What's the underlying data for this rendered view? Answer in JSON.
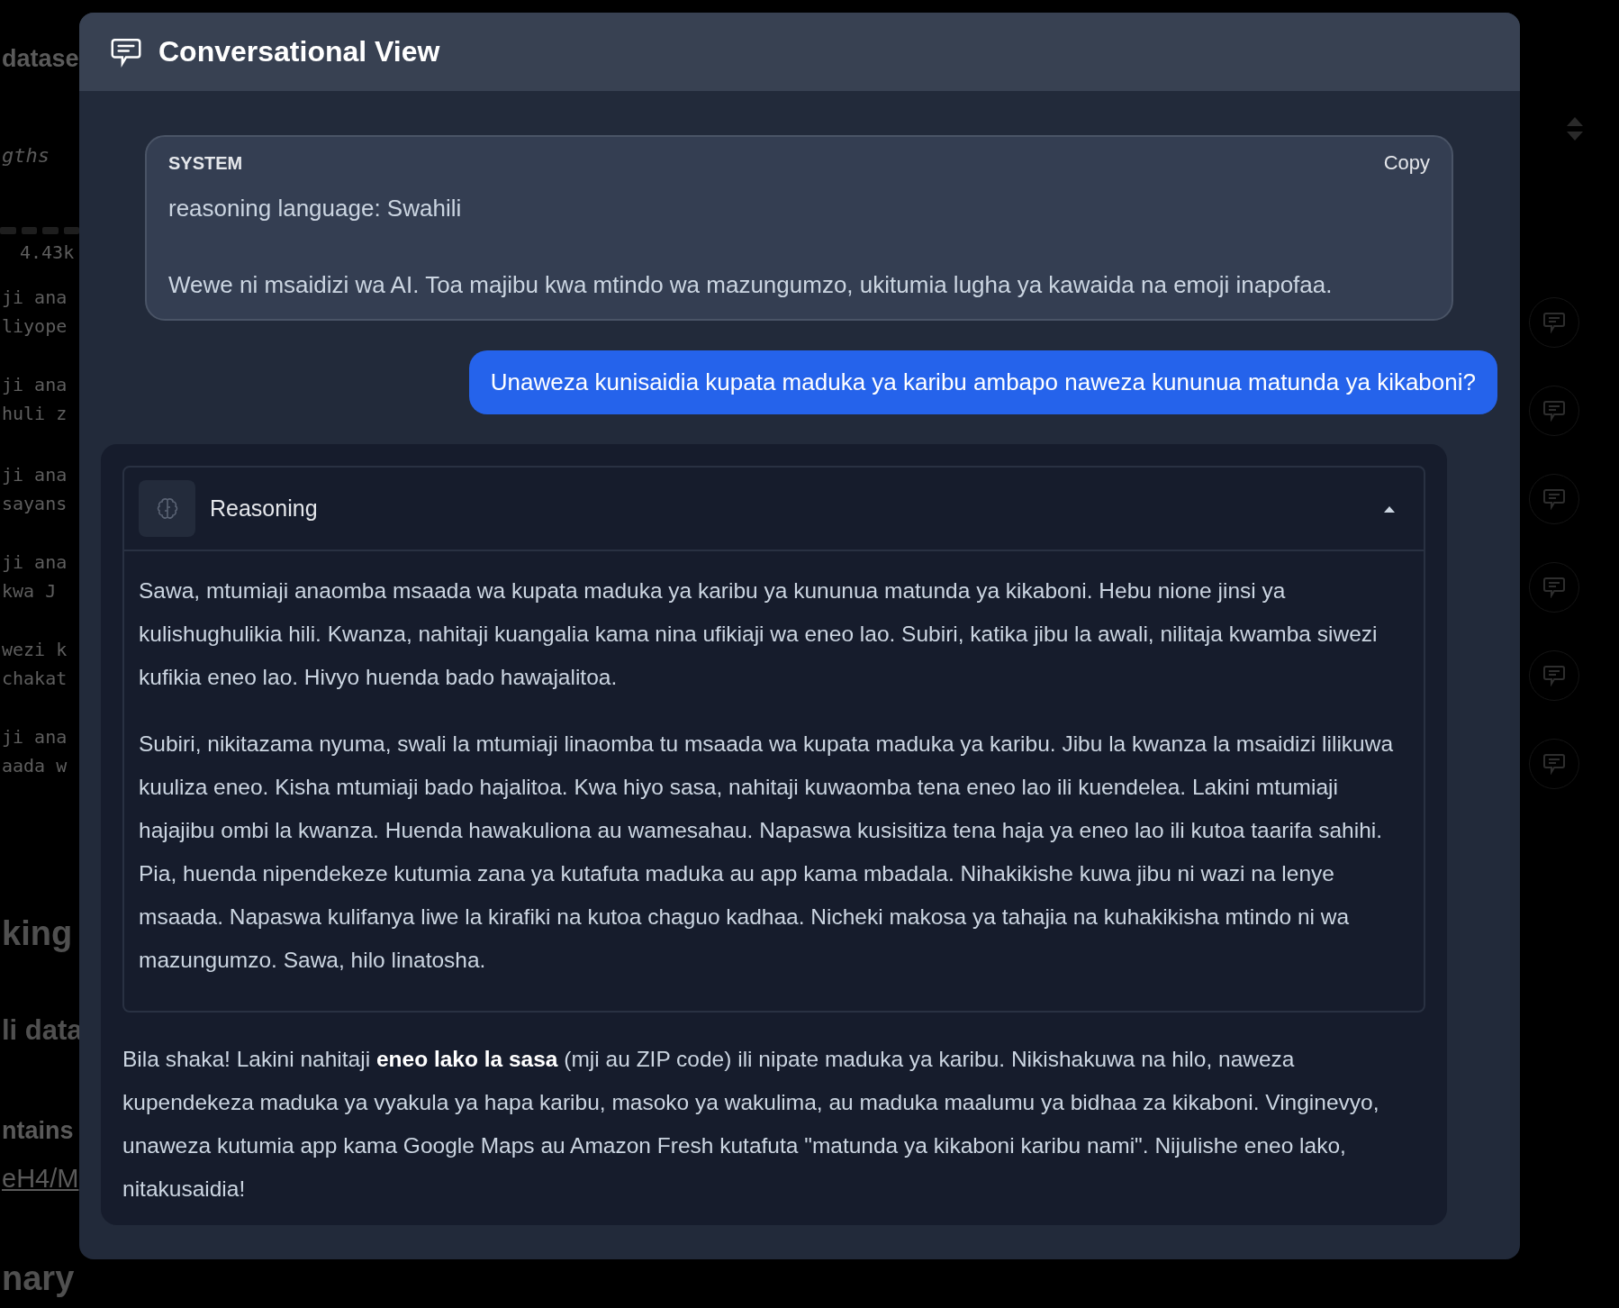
{
  "background": {
    "fragments": [
      {
        "text": "datase",
        "kind": "title"
      },
      {
        "text": "gths",
        "kind": "italic"
      },
      {
        "text": "4.43k",
        "kind": "mono"
      },
      {
        "text": "ji ana",
        "kind": "mono"
      },
      {
        "text": "liyope",
        "kind": "mono"
      },
      {
        "text": "ji ana",
        "kind": "mono"
      },
      {
        "text": "huli z",
        "kind": "mono"
      },
      {
        "text": "ji ana",
        "kind": "mono"
      },
      {
        "text": "sayans",
        "kind": "mono"
      },
      {
        "text": "ji ana",
        "kind": "mono"
      },
      {
        "text": "kwa J",
        "kind": "mono"
      },
      {
        "text": "wezi k",
        "kind": "mono"
      },
      {
        "text": "chakat",
        "kind": "mono"
      },
      {
        "text": "ji ana",
        "kind": "mono"
      },
      {
        "text": "aada w",
        "kind": "mono"
      },
      {
        "text": "king",
        "kind": "heading"
      },
      {
        "text": "li data",
        "kind": "subheading"
      },
      {
        "text": "ntains",
        "kind": "title"
      },
      {
        "text": "eH4/M",
        "kind": "link"
      },
      {
        "text": "nary",
        "kind": "heading"
      }
    ]
  },
  "dialog": {
    "title": "Conversational View",
    "messages": [
      {
        "kind": "system",
        "role": "SYSTEM",
        "copy": "Copy",
        "paragraphs": [
          "reasoning language: Swahili",
          "Wewe ni msaidizi wa AI. Toa majibu kwa mtindo wa mazungumzo, ukitumia lugha ya kawaida na emoji inapofaa."
        ]
      },
      {
        "kind": "user",
        "text": "Unaweza kunisaidia kupata maduka ya karibu ambapo naweza kununua matunda ya kikaboni?"
      },
      {
        "kind": "assistant",
        "reasoning": {
          "label": "Reasoning",
          "expanded": true,
          "paragraphs": [
            "Sawa, mtumiaji anaomba msaada wa kupata maduka ya karibu ya kununua matunda ya kikaboni. Hebu nione jinsi ya kulishughulikia hili. Kwanza, nahitaji kuangalia kama nina ufikiaji wa eneo lao. Subiri, katika jibu la awali, nilitaja kwamba siwezi kufikia eneo lao. Hivyo huenda bado hawajalitoa.",
            "Subiri, nikitazama nyuma, swali la mtumiaji linaomba tu msaada wa kupata maduka ya karibu. Jibu la kwanza la msaidizi lilikuwa kuuliza eneo. Kisha mtumiaji bado hajalitoa. Kwa hiyo sasa, nahitaji kuwaomba tena eneo lao ili kuendelea. Lakini mtumiaji hajajibu ombi la kwanza. Huenda hawakuliona au wamesahau. Napaswa kusisitiza tena haja ya eneo lao ili kutoa taarifa sahihi. Pia, huenda nipendekeze kutumia zana ya kutafuta maduka au app kama mbadala. Nihakikishe kuwa jibu ni wazi na lenye msaada. Napaswa kulifanya liwe la kirafiki na kutoa chaguo kadhaa. Nicheki makosa ya tahajia na kuhakikisha mtindo ni wa mazungumzo. Sawa, hilo linatosha."
          ]
        },
        "text": "Bila shaka! Lakini nahitaji **eneo lako la sasa** (mji au ZIP code) ili nipate maduka ya karibu. Nikishakuwa na hilo, naweza kupendekeza maduka ya vyakula ya hapa karibu, masoko ya wakulima, au maduka maalumu ya bidhaa za kikaboni. Vinginevyo, unaweza kutumia app kama Google Maps au Amazon Fresh kutafuta \"matunda ya kikaboni karibu nami\". Nijulishe eneo lako, nitakusaidia!"
      }
    ]
  }
}
